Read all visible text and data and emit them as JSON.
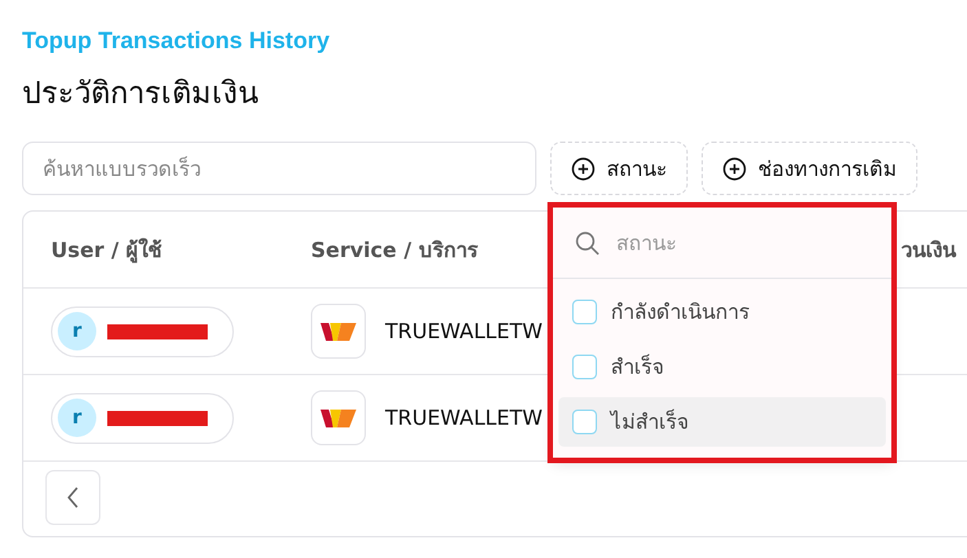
{
  "header": {
    "subtitle": "Topup Transactions History",
    "title": "ประวัติการเติมเงิน"
  },
  "search": {
    "placeholder": "ค้นหาแบบรวดเร็ว"
  },
  "filters": [
    {
      "label": "สถานะ"
    },
    {
      "label": "ช่องทางการเติม"
    }
  ],
  "table": {
    "columns": [
      "User / ผู้ใช้",
      "Service / บริการ",
      "วนเงิน"
    ],
    "rows": [
      {
        "avatar": "r",
        "service": "TRUEWALLETW"
      },
      {
        "avatar": "r",
        "service": "TRUEWALLETW"
      }
    ]
  },
  "dropdown": {
    "search_placeholder": "สถานะ",
    "options": [
      {
        "label": "กำลังดำเนินการ",
        "checked": false,
        "hovered": false
      },
      {
        "label": "สำเร็จ",
        "checked": false,
        "hovered": false
      },
      {
        "label": "ไม่สำเร็จ",
        "checked": false,
        "hovered": true
      }
    ]
  }
}
